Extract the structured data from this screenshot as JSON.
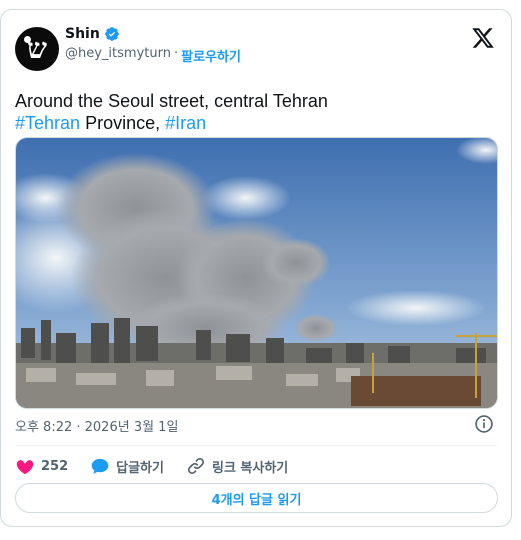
{
  "author": {
    "display_name": "Shin",
    "handle": "@hey_itsmyturn",
    "separator": "·",
    "follow_label": "팔로우하기",
    "avatar_glyph": "ש",
    "verified_color": "#1d9bf0"
  },
  "tweet": {
    "line1": "Around the  Seoul street, central Tehran",
    "hashtag1": "#Tehran",
    "middle_text": " Province, ",
    "hashtag2": "#Iran",
    "timestamp": "오후 8:22 · 2026년 3월 1일"
  },
  "actions": {
    "like_count": "252",
    "reply_label": "답글하기",
    "copy_link_label": "링크 복사하기"
  },
  "read_replies_label": "4개의 답글 읽기",
  "colors": {
    "accent": "#1d9bf0",
    "like": "#f91880",
    "muted": "#536471",
    "border": "#cfd9de"
  },
  "icons": [
    "verified-badge-icon",
    "x-logo-icon",
    "info-icon",
    "heart-icon",
    "reply-bubble-icon",
    "link-icon"
  ]
}
